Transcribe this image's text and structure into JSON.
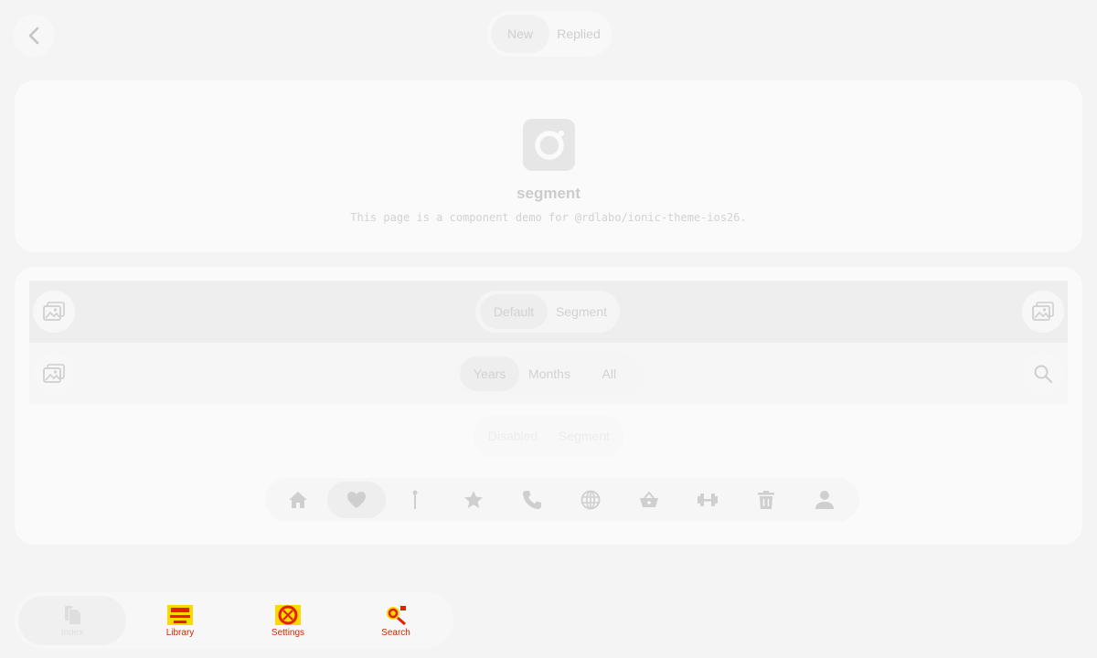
{
  "header": {
    "segments": [
      {
        "label": "New",
        "active": true
      },
      {
        "label": "Replied",
        "active": false
      }
    ]
  },
  "intro": {
    "title": "segment",
    "subtitle": "This page is a component demo for @rdlabo/ionic-theme-ios26."
  },
  "demo": {
    "toolbar1": {
      "segments": [
        "Default",
        "Segment"
      ],
      "start_icon": "image-icon",
      "end_icon": "image-icon"
    },
    "toolbar2": {
      "segments": [
        "Years",
        "Months",
        "All"
      ],
      "start_icon": "image-icon",
      "end_icon": "search-icon"
    },
    "toolbar3": {
      "segments": [
        "Disabled",
        "Segment"
      ]
    },
    "icon_segments": [
      "home-icon",
      "heart-icon",
      "pin-icon",
      "star-icon",
      "call-icon",
      "globe-icon",
      "basket-icon",
      "barbell-icon",
      "trash-icon",
      "person-icon"
    ]
  },
  "tabbar": {
    "tabs": [
      {
        "label": "Index",
        "icon": "documents-icon",
        "active": true
      },
      {
        "label": "Library",
        "icon": "library-icon",
        "active": false
      },
      {
        "label": "Settings",
        "icon": "settings-icon",
        "active": false
      },
      {
        "label": "Search",
        "icon": "search-icon",
        "active": false
      }
    ]
  },
  "colors": {
    "background": "#f4f4f4",
    "card": "#fafafa",
    "muted_text": "#c8c8c8",
    "broken_icon": "#cc2a00"
  }
}
